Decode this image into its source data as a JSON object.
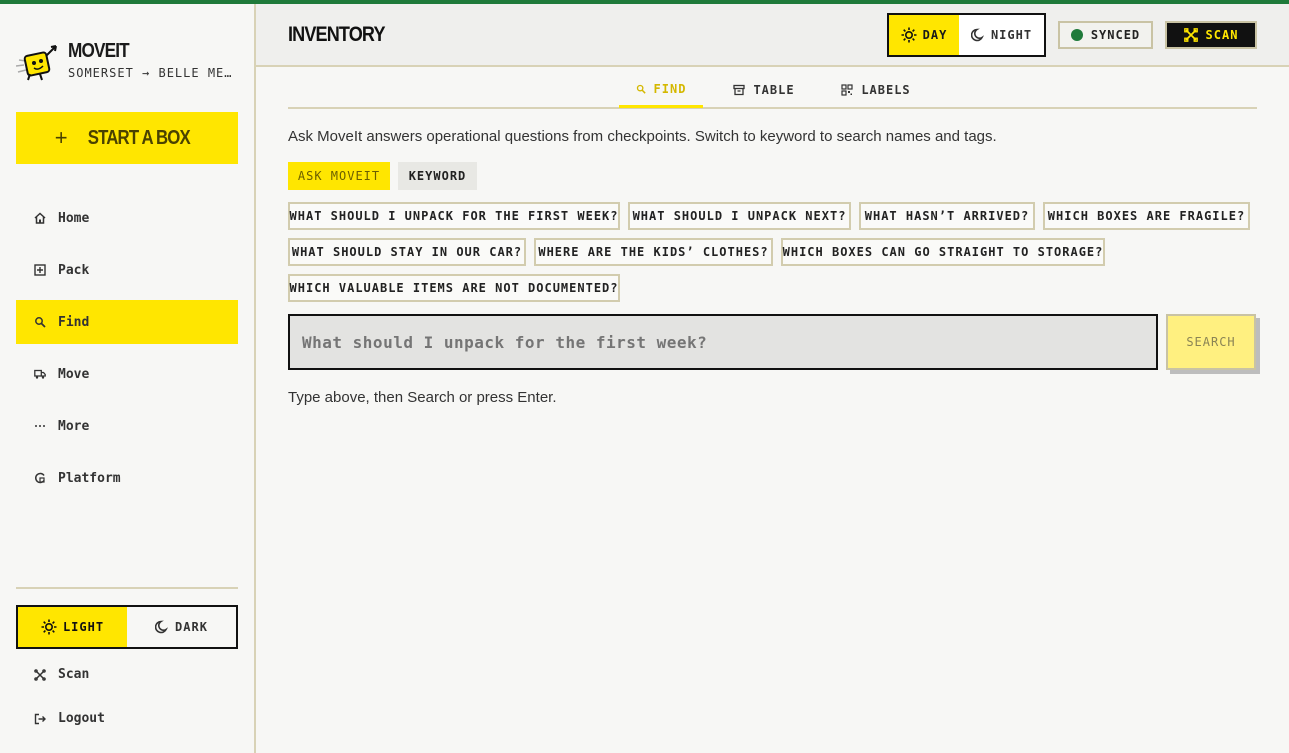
{
  "brand": {
    "name": "MOVEIT",
    "subtitle": "SOMERSET → BELLE ME…"
  },
  "sidebar": {
    "start_button": "START A BOX",
    "items": [
      {
        "label": "Home",
        "icon": "home-icon",
        "active": false
      },
      {
        "label": "Pack",
        "icon": "pack-icon",
        "active": false
      },
      {
        "label": "Find",
        "icon": "search-icon",
        "active": true
      },
      {
        "label": "Move",
        "icon": "truck-icon",
        "active": false
      },
      {
        "label": "More",
        "icon": "ellipsis-icon",
        "active": false
      },
      {
        "label": "Platform",
        "icon": "platform-icon",
        "active": false
      }
    ],
    "theme": {
      "light": "LIGHT",
      "dark": "DARK",
      "selected": "light"
    },
    "scan_label": "Scan",
    "logout_label": "Logout"
  },
  "header": {
    "title": "INVENTORY",
    "day_label": "DAY",
    "night_label": "NIGHT",
    "mode_selected": "day",
    "sync_label": "SYNCED",
    "sync_color": "#1f7a3a",
    "scan_label": "SCAN"
  },
  "tabs": [
    {
      "label": "FIND",
      "icon": "search-icon",
      "active": true
    },
    {
      "label": "TABLE",
      "icon": "archive-icon",
      "active": false
    },
    {
      "label": "LABELS",
      "icon": "qr-icon",
      "active": false
    }
  ],
  "find": {
    "intro": "Ask MoveIt answers operational questions from checkpoints. Switch to keyword to search names and tags.",
    "modes": {
      "ask": "ASK MOVEIT",
      "keyword": "KEYWORD",
      "selected": "ask"
    },
    "suggestions": [
      "WHAT SHOULD I UNPACK FOR THE FIRST WEEK?",
      "WHAT SHOULD I UNPACK NEXT?",
      "WHAT HASN’T ARRIVED?",
      "WHICH BOXES ARE FRAGILE?",
      "WHAT SHOULD STAY IN OUR CAR?",
      "WHERE ARE THE KIDS’ CLOTHES?",
      "WHICH BOXES CAN GO STRAIGHT TO STORAGE?",
      "WHICH VALUABLE ITEMS ARE NOT DOCUMENTED?"
    ],
    "search_placeholder": "What should I unpack for the first week?",
    "search_value": "",
    "search_button": "SEARCH",
    "hint": "Type above, then Search or press Enter."
  },
  "colors": {
    "accent": "#ffe600",
    "top_bar": "#1f7a3a",
    "border": "#d8d2b6"
  }
}
